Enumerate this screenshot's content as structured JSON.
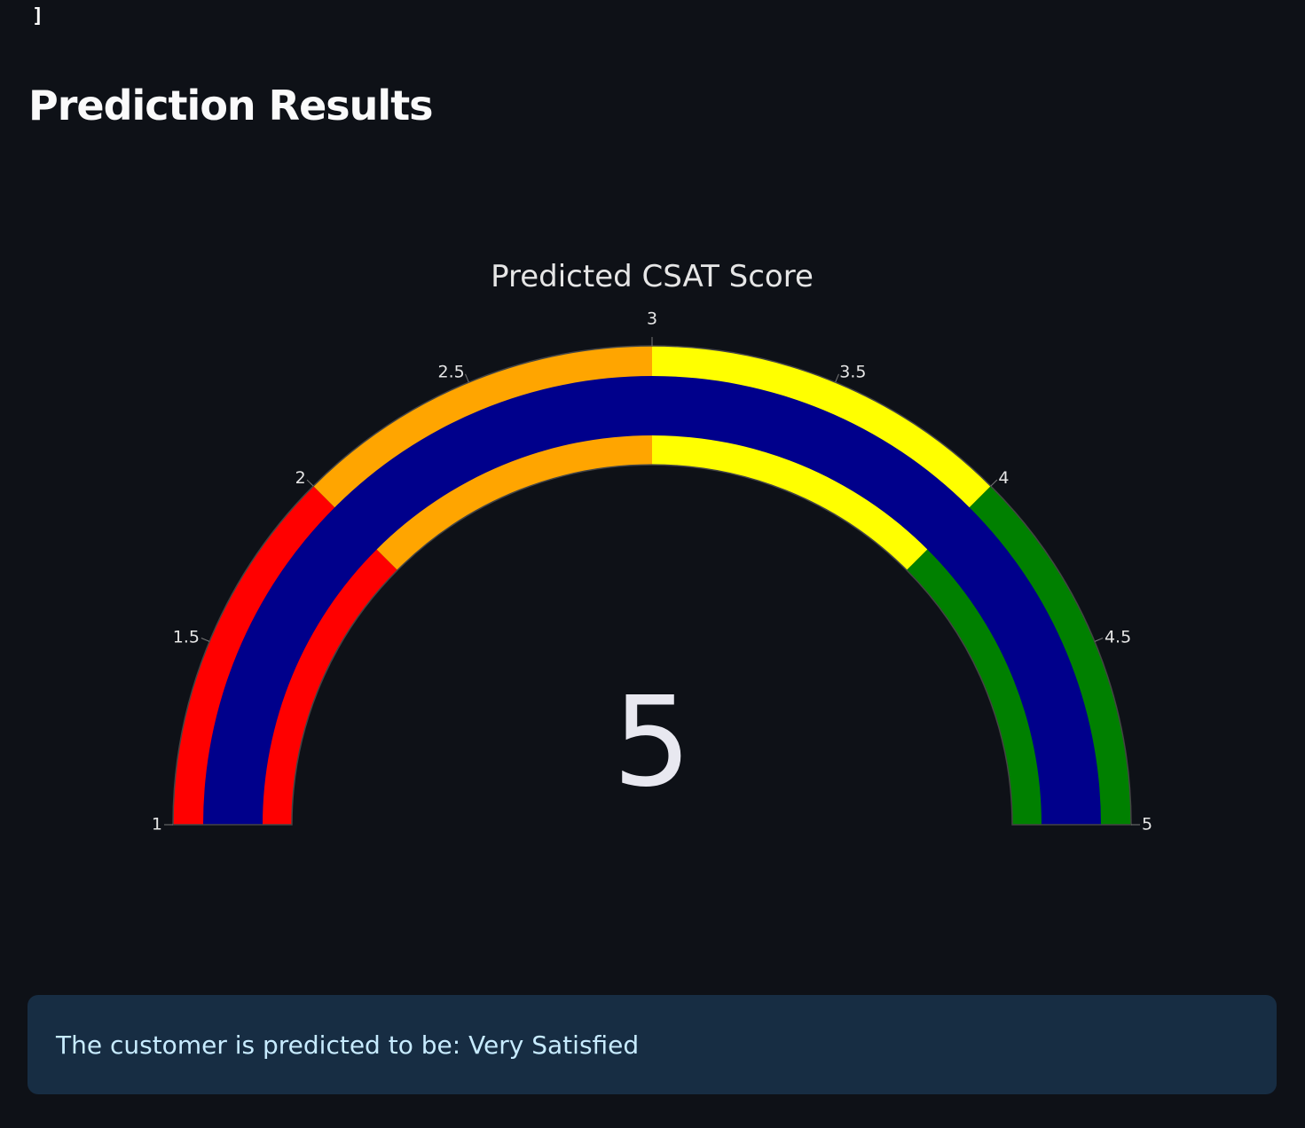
{
  "code_tail": "]",
  "page_title": "Prediction Results",
  "chart_data": {
    "type": "gauge",
    "title": "Predicted CSAT Score",
    "value": 5,
    "value_label": "5",
    "range": [
      1,
      5
    ],
    "ticks": [
      1,
      1.5,
      2,
      2.5,
      3,
      3.5,
      4,
      4.5,
      5
    ],
    "tick_labels": [
      "1",
      "1.5",
      "2",
      "2.5",
      "3",
      "3.5",
      "4",
      "4.5",
      "5"
    ],
    "steps": [
      {
        "range": [
          1,
          2
        ],
        "color": "#ff0000"
      },
      {
        "range": [
          2,
          3
        ],
        "color": "#ffa500"
      },
      {
        "range": [
          3,
          4
        ],
        "color": "#ffff00"
      },
      {
        "range": [
          4,
          5
        ],
        "color": "#008000"
      }
    ],
    "bar_color": "#00008b",
    "border_color": "#444444"
  },
  "info": {
    "message": "The customer is predicted to be: Very Satisfied"
  }
}
